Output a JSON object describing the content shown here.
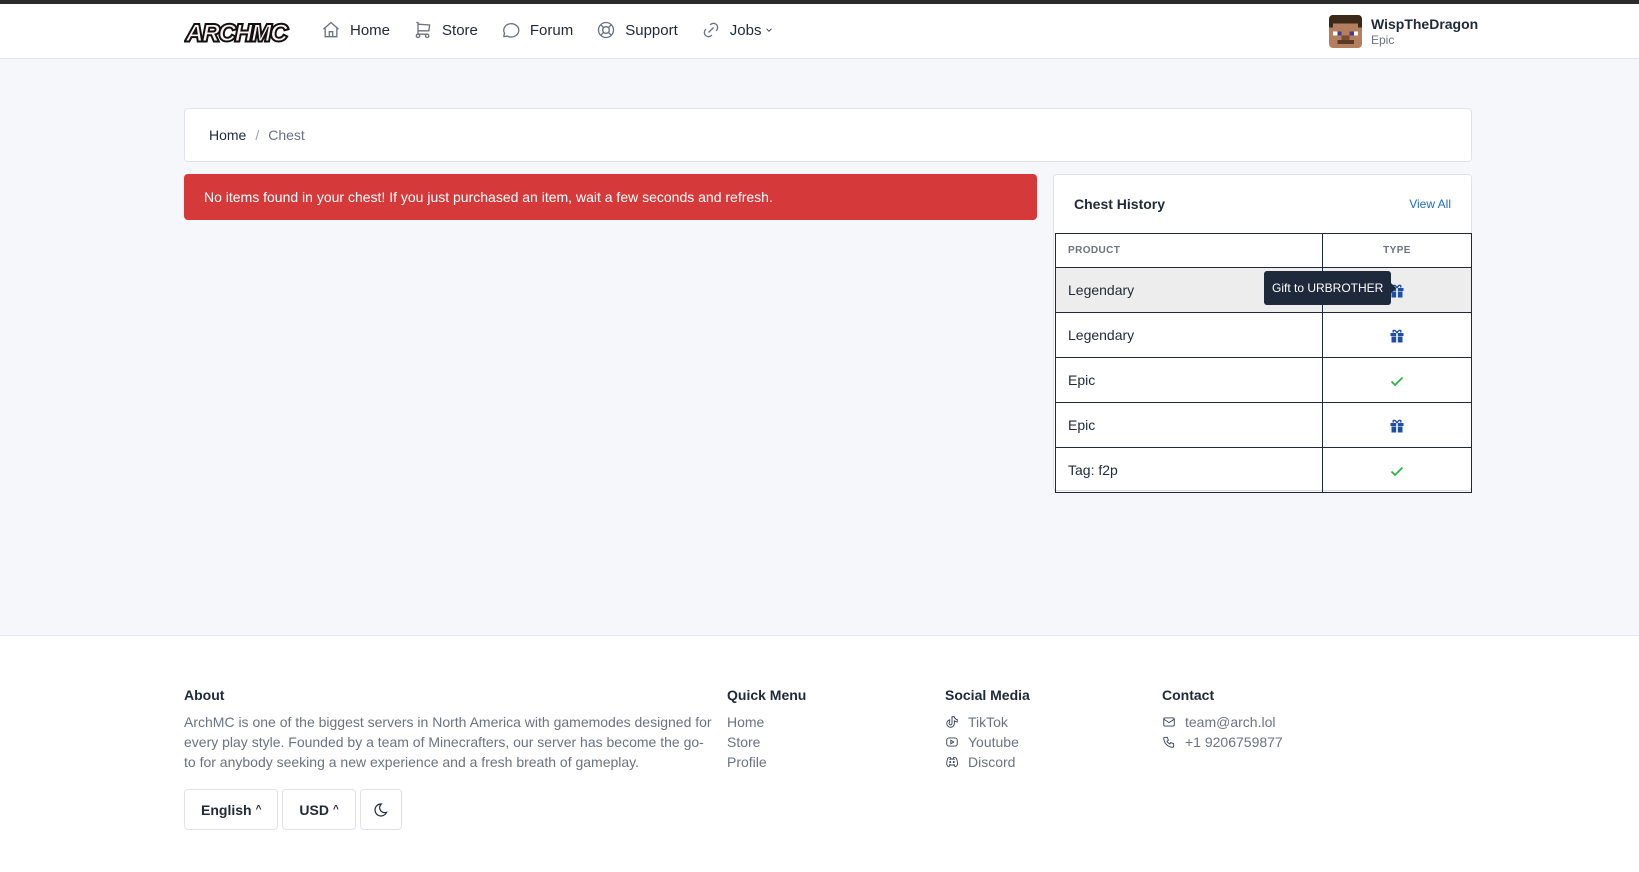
{
  "brand": {
    "logo_text": "ARCHMC"
  },
  "nav": {
    "items": [
      {
        "label": "Home",
        "icon": "home-icon"
      },
      {
        "label": "Store",
        "icon": "cart-icon"
      },
      {
        "label": "Forum",
        "icon": "chat-icon"
      },
      {
        "label": "Support",
        "icon": "lifebuoy-icon"
      },
      {
        "label": "Jobs",
        "icon": "link-icon",
        "dropdown": true
      }
    ]
  },
  "user": {
    "name": "WispTheDragon",
    "rank": "Epic"
  },
  "breadcrumb": {
    "home": "Home",
    "separator": "/",
    "current": "Chest"
  },
  "alert": {
    "message": "No items found in your chest! If you just purchased an item, wait a few seconds and refresh.",
    "color": "#d63939"
  },
  "chest_history": {
    "title": "Chest History",
    "view_all": "View All",
    "columns": [
      "Product",
      "Type"
    ],
    "rows": [
      {
        "product": "Legendary",
        "type": "gift"
      },
      {
        "product": "Legendary",
        "type": "gift"
      },
      {
        "product": "Epic",
        "type": "check"
      },
      {
        "product": "Epic",
        "type": "gift"
      },
      {
        "product": "Tag: f2p",
        "type": "check"
      }
    ],
    "tooltip": "Gift to URBROTHER"
  },
  "footer": {
    "about": {
      "heading": "About",
      "text": "ArchMC is one of the biggest servers in North America with gamemodes designed for every play style. Founded by a team of Minecrafters, our server has become the go-to for anybody seeking a new experience and a fresh breath of gameplay."
    },
    "quick_menu": {
      "heading": "Quick Menu",
      "links": [
        "Home",
        "Store",
        "Profile"
      ]
    },
    "social": {
      "heading": "Social Media",
      "links": [
        {
          "label": "TikTok",
          "icon": "tiktok-icon"
        },
        {
          "label": "Youtube",
          "icon": "youtube-icon"
        },
        {
          "label": "Discord",
          "icon": "discord-icon"
        }
      ]
    },
    "contact": {
      "heading": "Contact",
      "email": "team@arch.lol",
      "phone": "+1 9206759877"
    },
    "language": "English",
    "currency": "USD",
    "theme_icon": "moon-icon"
  },
  "colors": {
    "accent": "#206bc4",
    "danger": "#d63939",
    "success": "#2fb344"
  }
}
